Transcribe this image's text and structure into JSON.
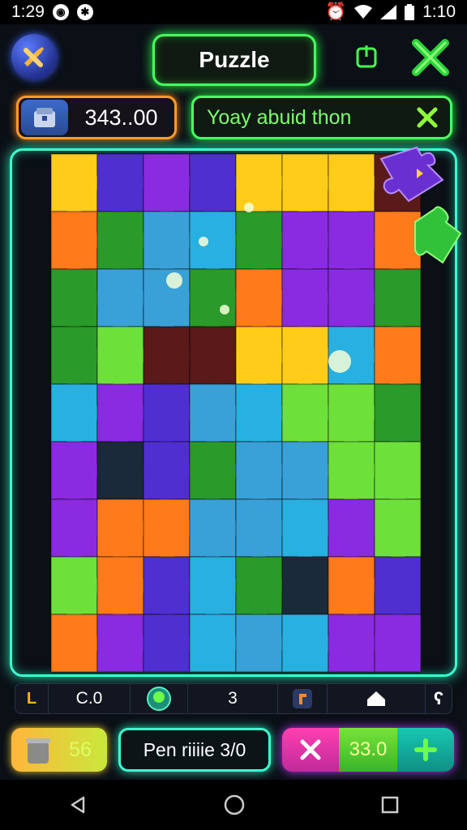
{
  "status_bar": {
    "time_left": "1:29",
    "time_right": "1:10"
  },
  "header": {
    "title": "Puzzle"
  },
  "score": {
    "value": "343..00"
  },
  "banner": {
    "text": "Yoay abuid thon"
  },
  "toolbar": {
    "level_letter": "L",
    "value1": "C.0",
    "value2": "3"
  },
  "bottom": {
    "coins": "56",
    "pen_label": "Pen riiiie 3/0",
    "combo_value": "33.0"
  },
  "colors": {
    "board_border": "#3dffd0",
    "title_border": "#49ff5d",
    "score_border": "#ff9a2a",
    "pieces": [
      "#ff7a1a",
      "#4f2fd0",
      "#8a2be2",
      "#2a9a2a",
      "#28b0e0",
      "#ffcc1a",
      "#6ee03a",
      "#1a2a3a",
      "#5a1a1a",
      "#3aa0d8"
    ]
  },
  "icons": {
    "header_left": "wrench-icon",
    "header_power": "power-icon",
    "header_close": "close-icon",
    "score": "chest-icon",
    "banner_close": "close-icon",
    "toolbar": [
      "l-icon",
      "gem-icon",
      "piece-icon",
      "home-icon",
      "info-icon"
    ],
    "coins": "trash-icon",
    "combo": [
      "close-icon",
      "plus-icon"
    ],
    "nav": [
      "back-icon",
      "home-icon",
      "recent-icon"
    ]
  }
}
